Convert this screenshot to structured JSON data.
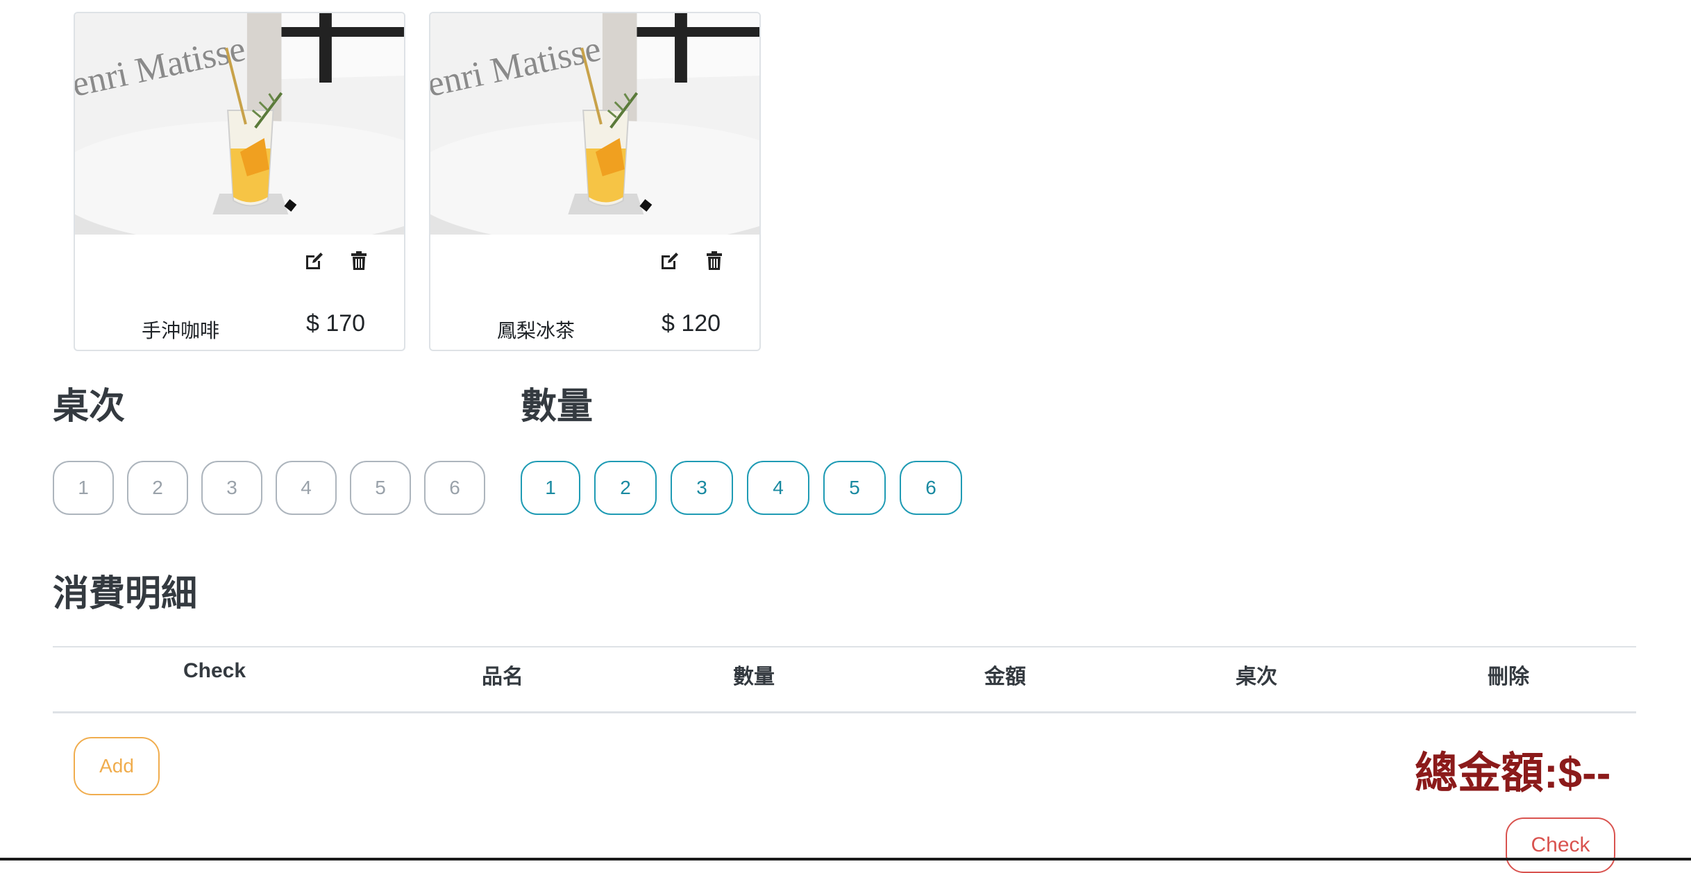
{
  "products": [
    {
      "name": "手沖咖啡",
      "price": "$ 170",
      "image_icon": "drink-photo",
      "edit_icon": "edit-icon",
      "delete_icon": "trash-icon"
    },
    {
      "name": "鳳梨冰茶",
      "price": "$ 120",
      "image_icon": "drink-photo",
      "edit_icon": "edit-icon",
      "delete_icon": "trash-icon"
    }
  ],
  "table_section": {
    "title": "桌次",
    "options": [
      "1",
      "2",
      "3",
      "4",
      "5",
      "6"
    ]
  },
  "quantity_section": {
    "title": "數量",
    "options": [
      "1",
      "2",
      "3",
      "4",
      "5",
      "6"
    ]
  },
  "details": {
    "title": "消費明細",
    "columns": [
      "Check",
      "品名",
      "數量",
      "金額",
      "桌次",
      "刪除"
    ]
  },
  "actions": {
    "add_label": "Add",
    "check_label": "Check"
  },
  "total": {
    "text": "總金額:$--"
  },
  "colors": {
    "total": "#8b1a1a",
    "add_button": "#f0ad4e",
    "check_button": "#d9534f",
    "quantity_pill": "#1f9bb4",
    "table_pill": "#adb5bd"
  }
}
